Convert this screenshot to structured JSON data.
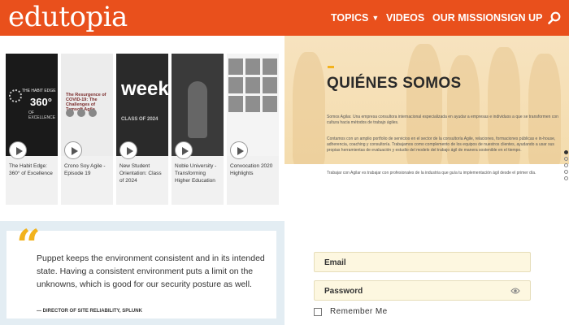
{
  "header": {
    "logo": "edutopia",
    "nav": [
      {
        "label": "TOPICS",
        "has_dropdown": true
      },
      {
        "label": "VIDEOS"
      },
      {
        "label": "OUR MISSION"
      },
      {
        "label": "SIGN UP"
      }
    ],
    "search_icon": "search-icon",
    "brand_color": "#e9501c"
  },
  "videos": [
    {
      "caption": "The Habit Edge: 360° of Excellence",
      "thumb": {
        "line1": "THE HABIT EDGE",
        "big": "360°",
        "line2": "OF EXCELLENCE"
      }
    },
    {
      "caption": "Crono Soy Agile - Episode 19",
      "thumb": {
        "heading": "The Resurgence of COVID-19: The Challenges of Tamsoft Agile"
      }
    },
    {
      "caption": "New Student Orientation: Class of 2024",
      "thumb": {
        "big": "week",
        "line": "CLASS OF 2024"
      }
    },
    {
      "caption": "Noble University - Transforming Higher Education",
      "thumb": {}
    },
    {
      "caption": "Convocation 2020 Highlights",
      "thumb": {}
    }
  ],
  "about": {
    "title": "QUIÉNES SOMOS",
    "paragraphs": [
      "Somos Agilar. Una empresa consultora internacional especializada en ayudar a empresas e individuos a que se transformen con cultura hacia métodos de trabajo ágiles.",
      "Contamos con un amplio portfolio de servicios en el sector de la consultoría Agile, relaciones, formaciones públicas e in-house, adherencia, coaching y consultoría. Trabajamos como complemento de los equipos de nuestros clientes, ayudando a usar sus propias herramientas de evaluación y estudio del modelo del trabajo ágil de manera sostenible en el tiempo.",
      "Trabajar con Agilar es trabajar con profesionales de la industria que guía tu implementación ágil desde el primer día."
    ],
    "accent_color": "#f3b21d"
  },
  "quote": {
    "text": "Puppet keeps the environment consistent and in its intended state. Having a consistent environment puts a limit on the unknowns, which is good for our security posture as well.",
    "attribution": "— DIRECTOR OF SITE RELIABILITY, SPLUNK"
  },
  "login": {
    "email_label": "Email",
    "password_label": "Password",
    "remember_label": "Remember Me"
  }
}
